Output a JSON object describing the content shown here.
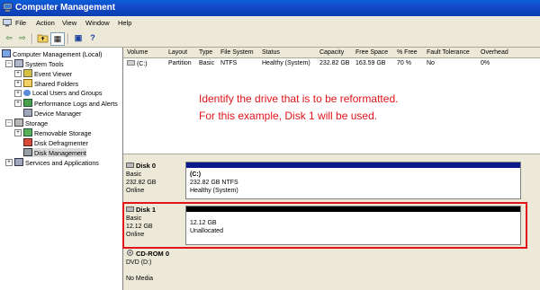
{
  "window": {
    "title": "Computer Management"
  },
  "menu": [
    "File",
    "Action",
    "View",
    "Window",
    "Help"
  ],
  "toolbar": {
    "back": "⇦",
    "forward": "⇨",
    "up": "↥",
    "show_hide": "▦",
    "help": "?",
    "properties": "▣"
  },
  "tree": [
    {
      "label": "Computer Management (Local)",
      "depth": 0,
      "expander": "−"
    },
    {
      "label": "System Tools",
      "depth": 1,
      "expander": "−"
    },
    {
      "label": "Event Viewer",
      "depth": 2,
      "expander": "+"
    },
    {
      "label": "Shared Folders",
      "depth": 2,
      "expander": "+"
    },
    {
      "label": "Local Users and Groups",
      "depth": 2,
      "expander": "+"
    },
    {
      "label": "Performance Logs and Alerts",
      "depth": 2,
      "expander": "+"
    },
    {
      "label": "Device Manager",
      "depth": 2,
      "expander": ""
    },
    {
      "label": "Storage",
      "depth": 1,
      "expander": "−"
    },
    {
      "label": "Removable Storage",
      "depth": 2,
      "expander": "+"
    },
    {
      "label": "Disk Defragmenter",
      "depth": 2,
      "expander": ""
    },
    {
      "label": "Disk Management",
      "depth": 2,
      "expander": ""
    },
    {
      "label": "Services and Applications",
      "depth": 1,
      "expander": "+"
    }
  ],
  "volume_table": {
    "headers": [
      "Volume",
      "Layout",
      "Type",
      "File System",
      "Status",
      "Capacity",
      "Free Space",
      "% Free",
      "Fault Tolerance",
      "Overhead"
    ],
    "rows": [
      [
        "(C:)",
        "Partition",
        "Basic",
        "NTFS",
        "Healthy (System)",
        "232.82 GB",
        "163.59 GB",
        "70 %",
        "No",
        "0%"
      ]
    ]
  },
  "annotation": {
    "line1": "Identify the drive that is to be reformatted.",
    "line2": "For this example, Disk 1 will be used.",
    "color": "#e0141a"
  },
  "disks": [
    {
      "name": "Disk 0",
      "type": "Basic",
      "size": "232.82 GB",
      "state": "Online",
      "part_name": "(C:)",
      "part_size": "232.82 GB NTFS",
      "part_status": "Healthy (System)"
    },
    {
      "name": "Disk 1",
      "type": "Basic",
      "size": "12.12 GB",
      "state": "Online",
      "part_size": "12.12 GB",
      "part_status": "Unallocated"
    },
    {
      "name": "CD-ROM 0",
      "type": "DVD (D:)",
      "state": "No Media"
    }
  ]
}
